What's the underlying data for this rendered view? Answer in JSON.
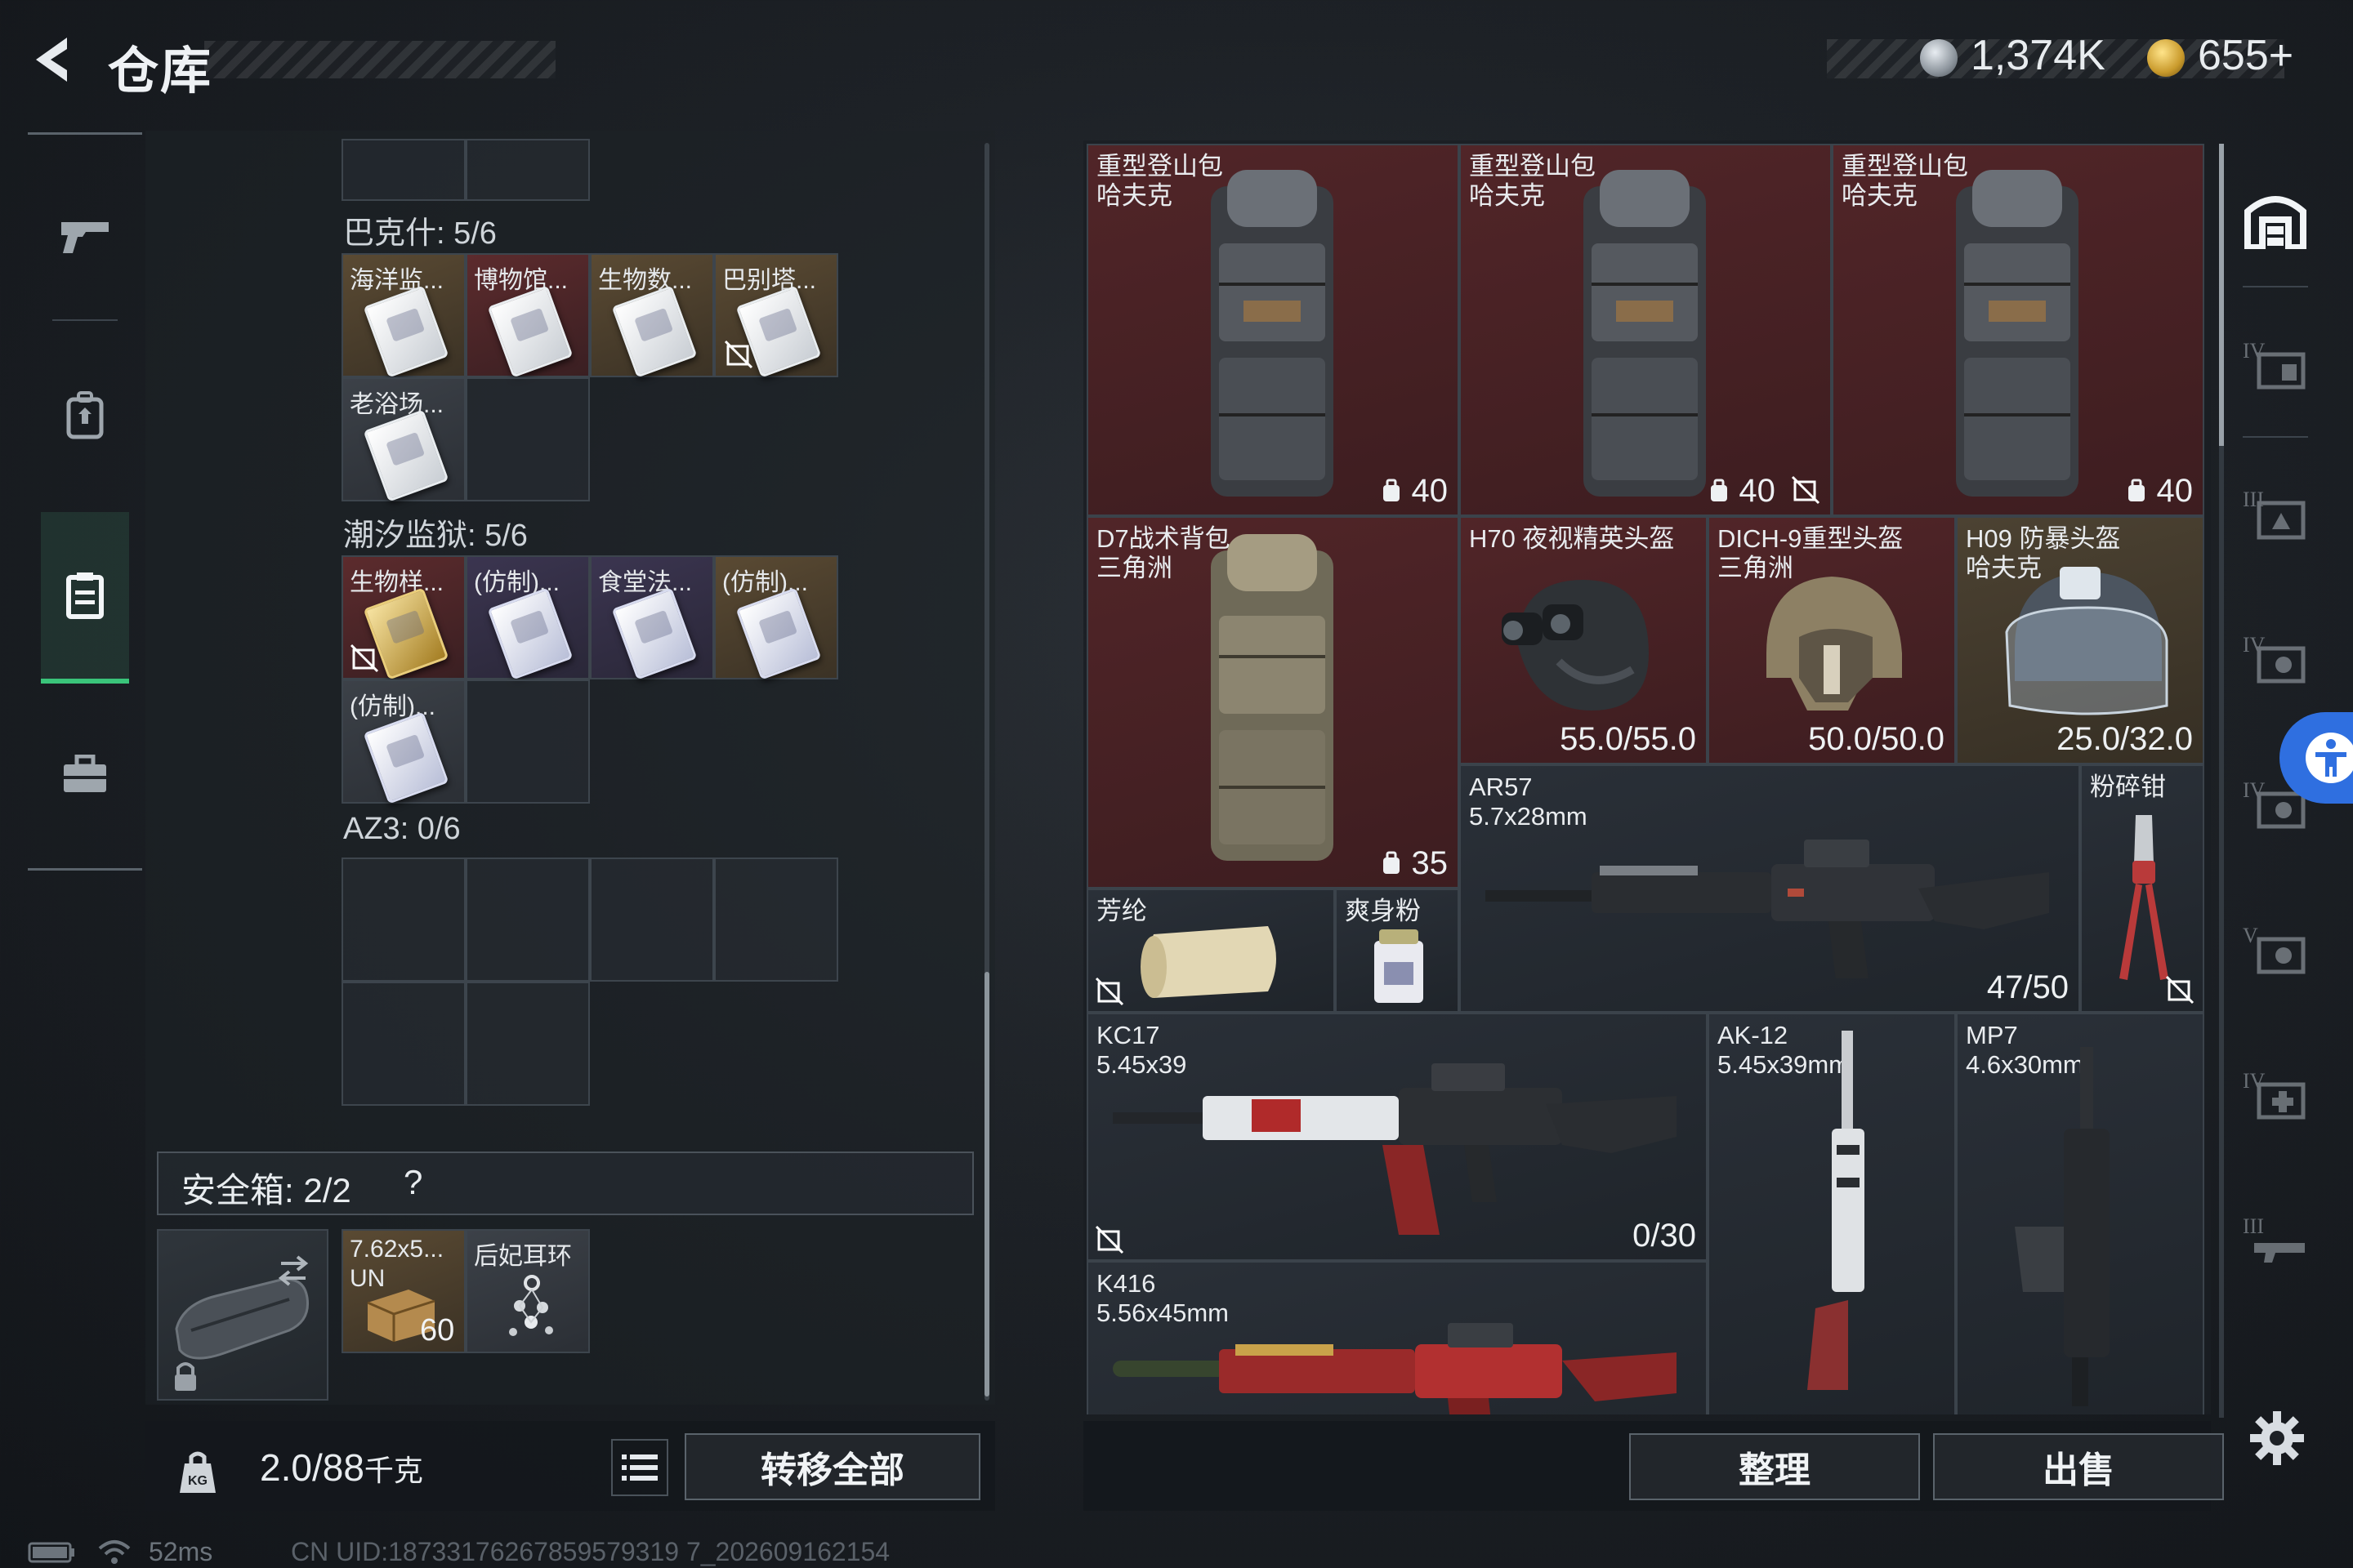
{
  "header": {
    "title": "仓库",
    "currency_1": "1,374K",
    "currency_2": "655+"
  },
  "container": {
    "sections": [
      {
        "title": "巴克什: 5/6",
        "items": [
          "海洋监...",
          "博物馆...",
          "生物数...",
          "巴别塔...",
          "老浴场..."
        ]
      },
      {
        "title": "潮汐监狱: 5/6",
        "items": [
          "生物样...",
          "(仿制)...",
          "食堂法...",
          "(仿制)...",
          "(仿制)..."
        ]
      },
      {
        "title": "AZ3: 0/6",
        "items": []
      }
    ],
    "safe_box": {
      "label": "安全箱: 2/2",
      "help": "?",
      "items": [
        {
          "label": "7.62x5...",
          "sub": "UN",
          "count": "60"
        },
        {
          "label": "后妃耳环"
        }
      ]
    },
    "weight": {
      "current": "2.0",
      "max": "/88",
      "unit": "千克"
    },
    "transfer_all": "转移全部"
  },
  "stash": {
    "items": [
      {
        "name": "重型登山包",
        "sub": "哈夫克",
        "value": "40"
      },
      {
        "name": "重型登山包",
        "sub": "哈夫克",
        "value": "40"
      },
      {
        "name": "重型登山包",
        "sub": "哈夫克",
        "value": "40"
      },
      {
        "name": "D7战术背包",
        "sub": "三角洲",
        "value": "35"
      },
      {
        "name": "H70 夜视精英头盔",
        "value": "55.0/55.0"
      },
      {
        "name": "DICH-9重型头盔",
        "sub": "三角洲",
        "value": "50.0/50.0"
      },
      {
        "name": "H09 防暴头盔",
        "sub": "哈夫克",
        "value": "25.0/32.0"
      },
      {
        "name": "AR57",
        "sub": "5.7x28mm",
        "value": "47/50"
      },
      {
        "name": "粉碎钳"
      },
      {
        "name": "芳纶"
      },
      {
        "name": "爽身粉"
      },
      {
        "name": "KC17",
        "sub": "5.45x39",
        "value": "0/30"
      },
      {
        "name": "AK-12",
        "sub": "5.45x39mm"
      },
      {
        "name": "MP7",
        "sub": "4.6x30mm"
      },
      {
        "name": "K416",
        "sub": "5.56x45mm"
      }
    ],
    "sort": "整理",
    "sell": "出售"
  },
  "status": {
    "ping": "52ms",
    "uid": "CN UID:18733176267859579319 7_202609162154"
  },
  "colors": {
    "accent_green": "#3ac47a",
    "accessibility_blue": "#2f6fe0",
    "red_rarity": "#512528",
    "gold_rarity": "#4c4232"
  }
}
